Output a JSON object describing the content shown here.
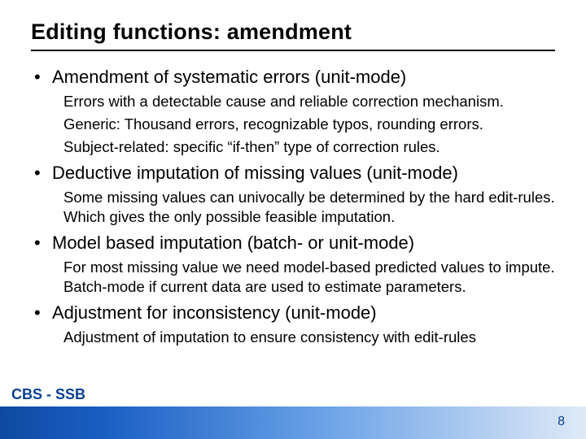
{
  "slide": {
    "title": "Editing functions: amendment",
    "bullets": [
      {
        "heading": "Amendment of systematic errors (unit-mode)",
        "lines": [
          "Errors with a detectable cause and reliable correction mechanism.",
          "Generic: Thousand errors, recognizable typos, rounding errors.",
          "Subject-related: specific “if-then” type of correction rules."
        ]
      },
      {
        "heading": "Deductive imputation of missing values (unit-mode)",
        "lines": [
          "Some missing values can univocally be determined by the hard edit-rules. Which gives the only possible feasible imputation."
        ]
      },
      {
        "heading": "Model based imputation (batch- or unit-mode)",
        "lines": [
          "For most missing value we need model-based predicted values to impute. Batch-mode if current data are used to estimate parameters."
        ]
      },
      {
        "heading": "Adjustment for inconsistency (unit-mode)",
        "lines": [
          "Adjustment of imputation to ensure consistency with edit-rules"
        ]
      }
    ],
    "footer_left": "CBS - SSB",
    "page_number": "8"
  }
}
